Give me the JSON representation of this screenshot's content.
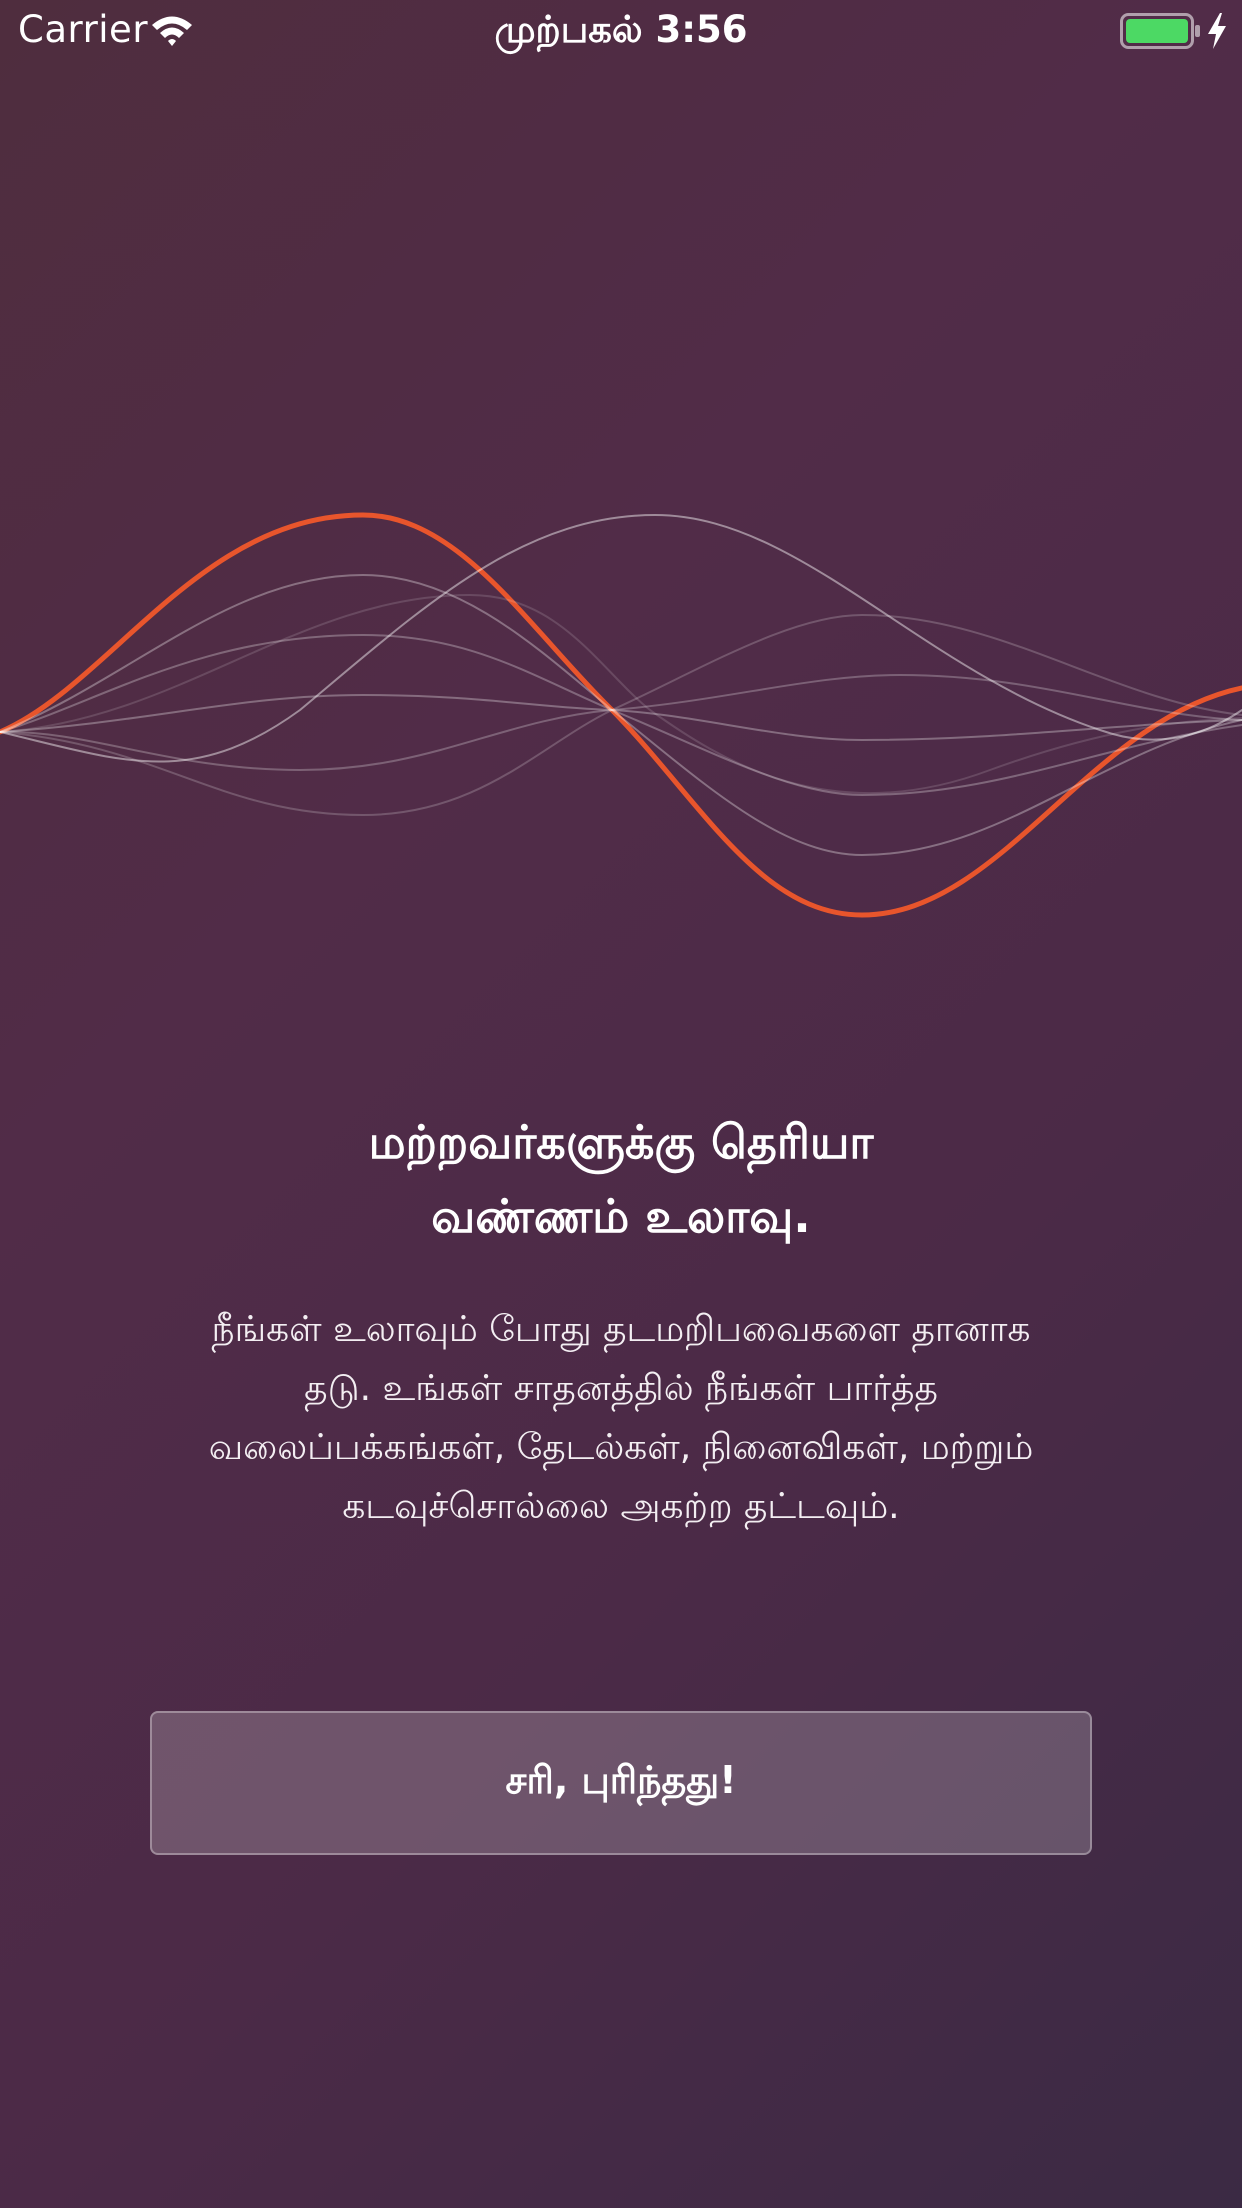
{
  "status_bar": {
    "carrier": "Carrier",
    "time": "முற்பகல் 3:56",
    "battery_color": "#4cd964",
    "icons": [
      "wifi-icon",
      "battery-icon",
      "charging-bolt-icon"
    ]
  },
  "illustration": {
    "icon": "sound-wave-icon",
    "accent_color": "#e8552c"
  },
  "onboarding": {
    "headline_lines": [
      "மற்றவர்களுக்கு தெரியா",
      "வண்ணம் உலாவு."
    ],
    "description_lines": [
      "நீங்கள் உலாவும் போது தடமறிபவைகளை தானாக",
      "தடு. உங்கள் சாதனத்தில் நீங்கள் பார்த்த",
      "வலைப்பக்கங்கள், தேடல்கள், நினைவிகள், மற்றும்",
      "கடவுச்சொல்லை அகற்ற தட்டவும்."
    ],
    "confirm_button": "சரி, புரிந்தது!"
  }
}
